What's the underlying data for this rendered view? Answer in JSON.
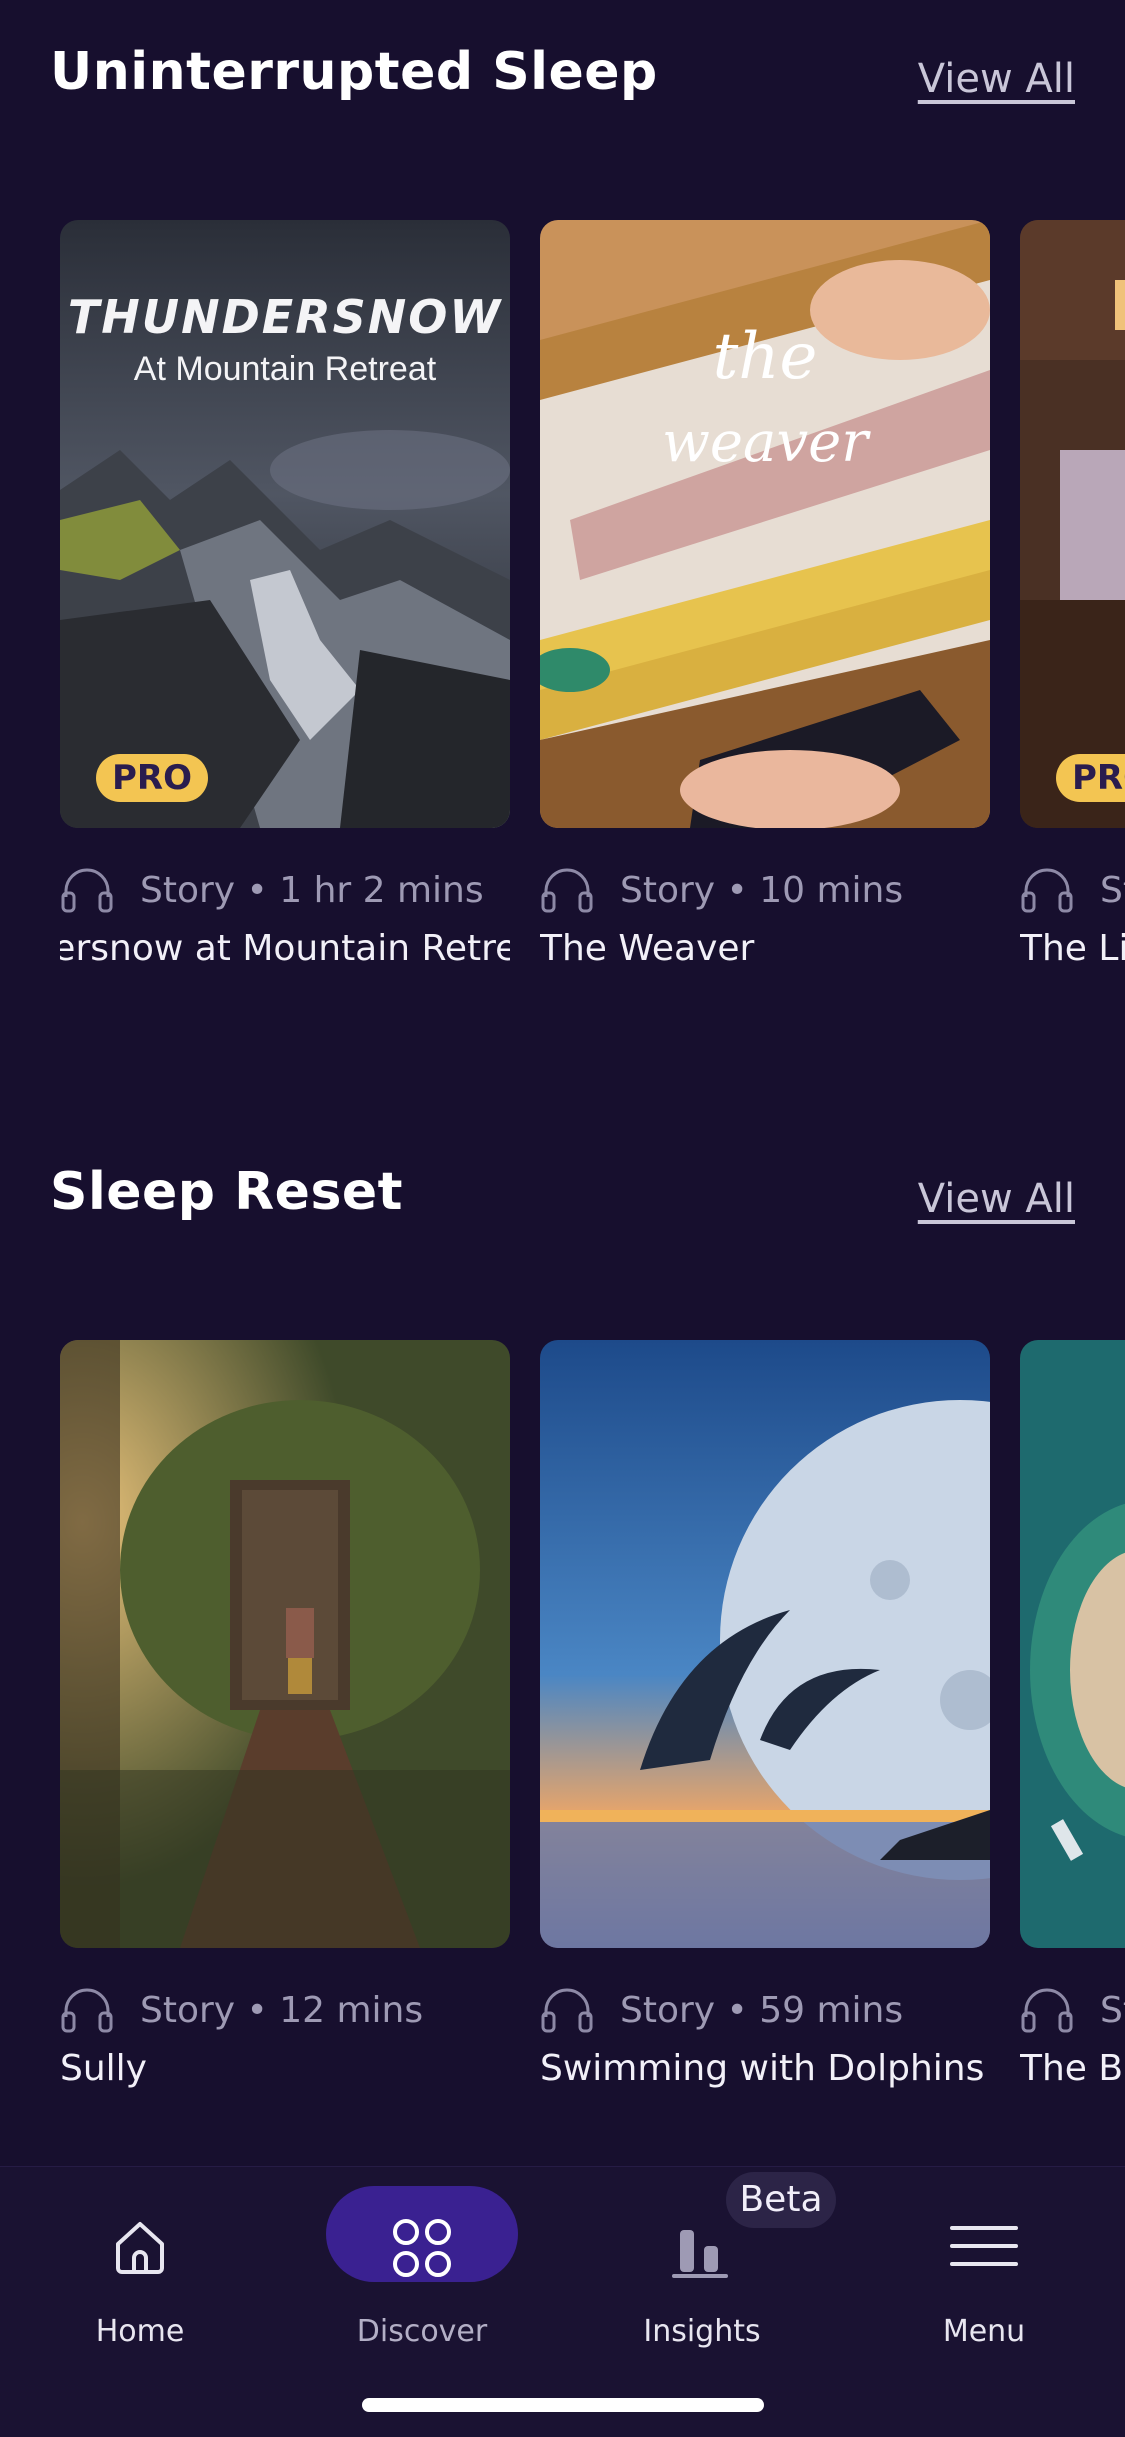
{
  "sections": [
    {
      "title": "Uninterrupted Sleep",
      "view_all": "View All",
      "cards": [
        {
          "art_title": "THUNDERSNOW",
          "art_subtitle": "At Mountain Retreat",
          "badge": "PRO",
          "meta": "Story • 1 hr 2 mins",
          "title": "Thundersnow at Mountain Retreat"
        },
        {
          "art_title": "the",
          "art_subtitle": "weaver",
          "meta": "Story • 10 mins",
          "title": "The Weaver"
        },
        {
          "badge": "PRO",
          "meta": "St",
          "title": "The Li"
        }
      ]
    },
    {
      "title": "Sleep Reset",
      "view_all": "View All",
      "cards": [
        {
          "meta": "Story • 12 mins",
          "title": "Sully"
        },
        {
          "meta": "Story • 59 mins",
          "title": "Swimming with Dolphins"
        },
        {
          "meta": "St",
          "title": "The Bo"
        }
      ]
    }
  ],
  "tabs": [
    {
      "label": "Home",
      "icon": "home-icon"
    },
    {
      "label": "Discover",
      "icon": "discover-icon",
      "active": true
    },
    {
      "label": "Insights",
      "icon": "insights-icon",
      "badge": "Beta"
    },
    {
      "label": "Menu",
      "icon": "menu-icon"
    }
  ],
  "colors": {
    "background": "#170f2e",
    "accent": "#3a2191",
    "pro_badge": "#f3c552"
  }
}
